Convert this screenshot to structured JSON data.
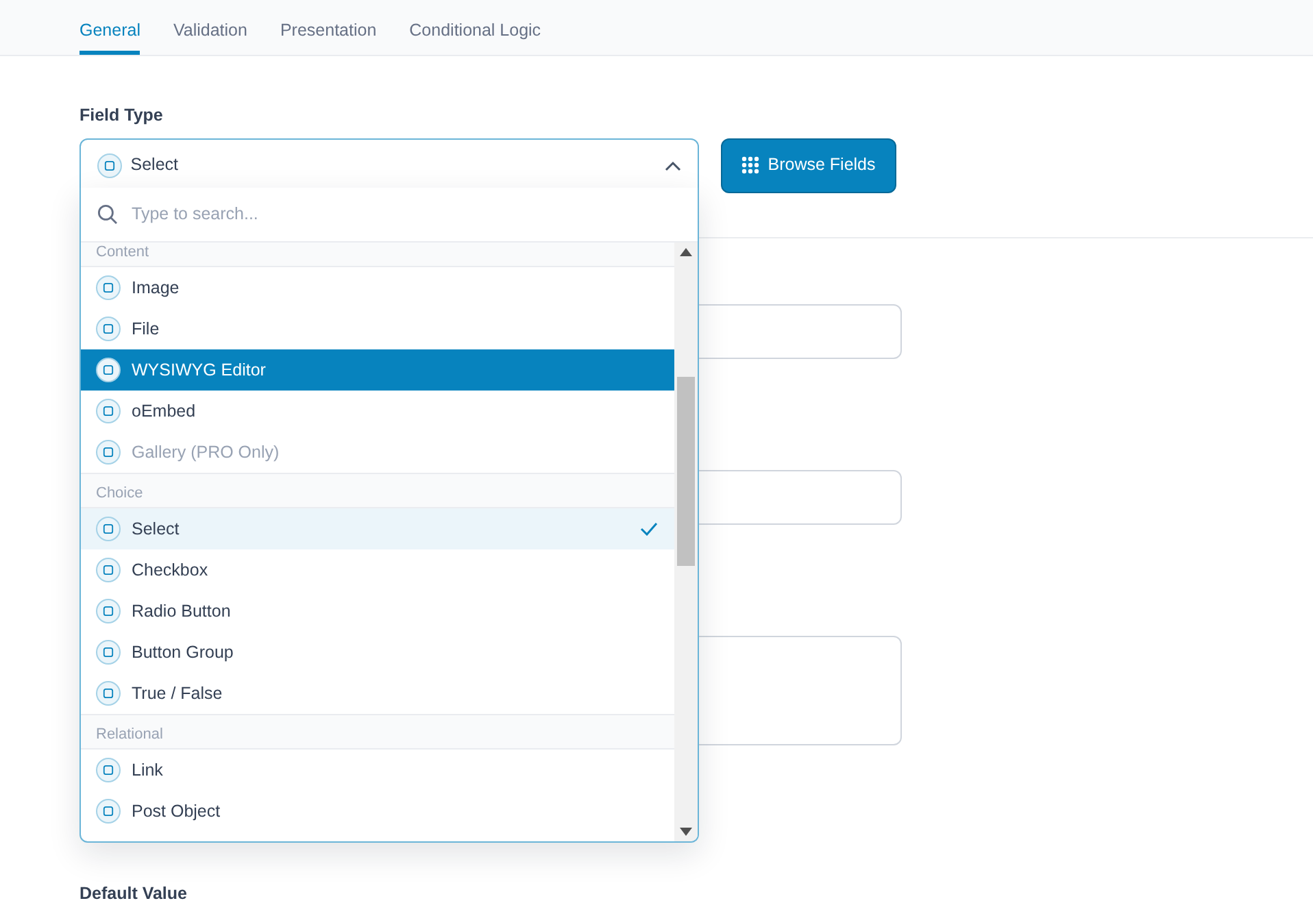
{
  "tabs": [
    {
      "label": "General",
      "selected": true
    },
    {
      "label": "Validation",
      "selected": false
    },
    {
      "label": "Presentation",
      "selected": false
    },
    {
      "label": "Conditional Logic",
      "selected": false
    }
  ],
  "field_type": {
    "label": "Field Type",
    "value": "Select",
    "expanded": true,
    "browse_button": "Browse Fields"
  },
  "dropdown": {
    "search": {
      "placeholder": "Type to search..."
    },
    "items": [
      {
        "kind": "group",
        "label": "Content"
      },
      {
        "kind": "option",
        "label": "Image",
        "highlighted": false,
        "selected": false,
        "disabled": false
      },
      {
        "kind": "option",
        "label": "File",
        "highlighted": false,
        "selected": false,
        "disabled": false
      },
      {
        "kind": "option",
        "label": "WYSIWYG Editor",
        "highlighted": true,
        "selected": false,
        "disabled": false
      },
      {
        "kind": "option",
        "label": "oEmbed",
        "highlighted": false,
        "selected": false,
        "disabled": false
      },
      {
        "kind": "option",
        "label": "Gallery (PRO Only)",
        "highlighted": false,
        "selected": false,
        "disabled": true
      },
      {
        "kind": "group",
        "label": "Choice"
      },
      {
        "kind": "option",
        "label": "Select",
        "highlighted": false,
        "selected": true,
        "disabled": false
      },
      {
        "kind": "option",
        "label": "Checkbox",
        "highlighted": false,
        "selected": false,
        "disabled": false
      },
      {
        "kind": "option",
        "label": "Radio Button",
        "highlighted": false,
        "selected": false,
        "disabled": false
      },
      {
        "kind": "option",
        "label": "Button Group",
        "highlighted": false,
        "selected": false,
        "disabled": false
      },
      {
        "kind": "option",
        "label": "True / False",
        "highlighted": false,
        "selected": false,
        "disabled": false
      },
      {
        "kind": "group",
        "label": "Relational"
      },
      {
        "kind": "option",
        "label": "Link",
        "highlighted": false,
        "selected": false,
        "disabled": false
      },
      {
        "kind": "option",
        "label": "Post Object",
        "highlighted": false,
        "selected": false,
        "disabled": false
      }
    ]
  },
  "default_value": {
    "label": "Default Value"
  }
}
